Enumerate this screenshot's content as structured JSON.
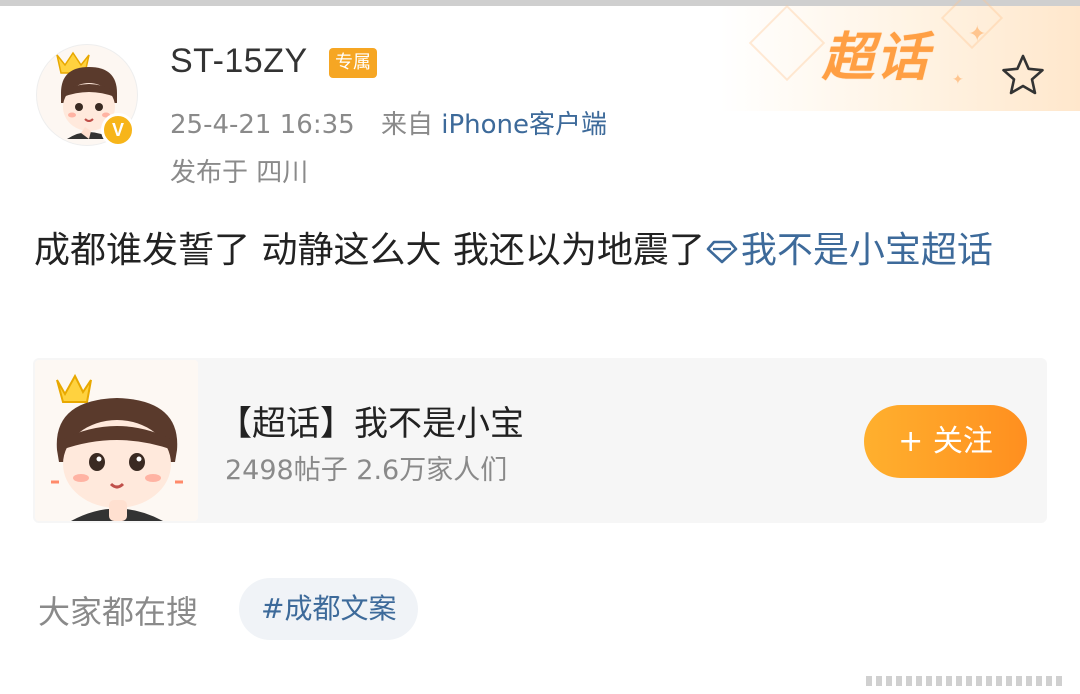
{
  "post": {
    "author": "ST-15ZY",
    "author_tag": "专属",
    "timestamp": "25-4-21 16:35",
    "source_prefix": "来自",
    "source": "iPhone客户端",
    "location": "发布于 四川",
    "text": "成都谁发誓了 动静这么大 我还以为地震了",
    "topic_link": "我不是小宝超话",
    "verified_badge": "V"
  },
  "supertopic_brand": "超话",
  "card": {
    "title": "【超话】我不是小宝",
    "stats": "2498帖子 2.6万家人们",
    "follow_label": "+ 关注"
  },
  "search": {
    "label": "大家都在搜",
    "chip": "#成都文案"
  },
  "colors": {
    "link": "#3d6a9a",
    "accent_orange": "#ff9f43",
    "tag_bg": "#f6a623",
    "badge_gold": "#f7b51a"
  },
  "icons": {
    "favorite": "star-icon",
    "topic": "diamond-icon",
    "verified": "verified-badge-icon"
  }
}
